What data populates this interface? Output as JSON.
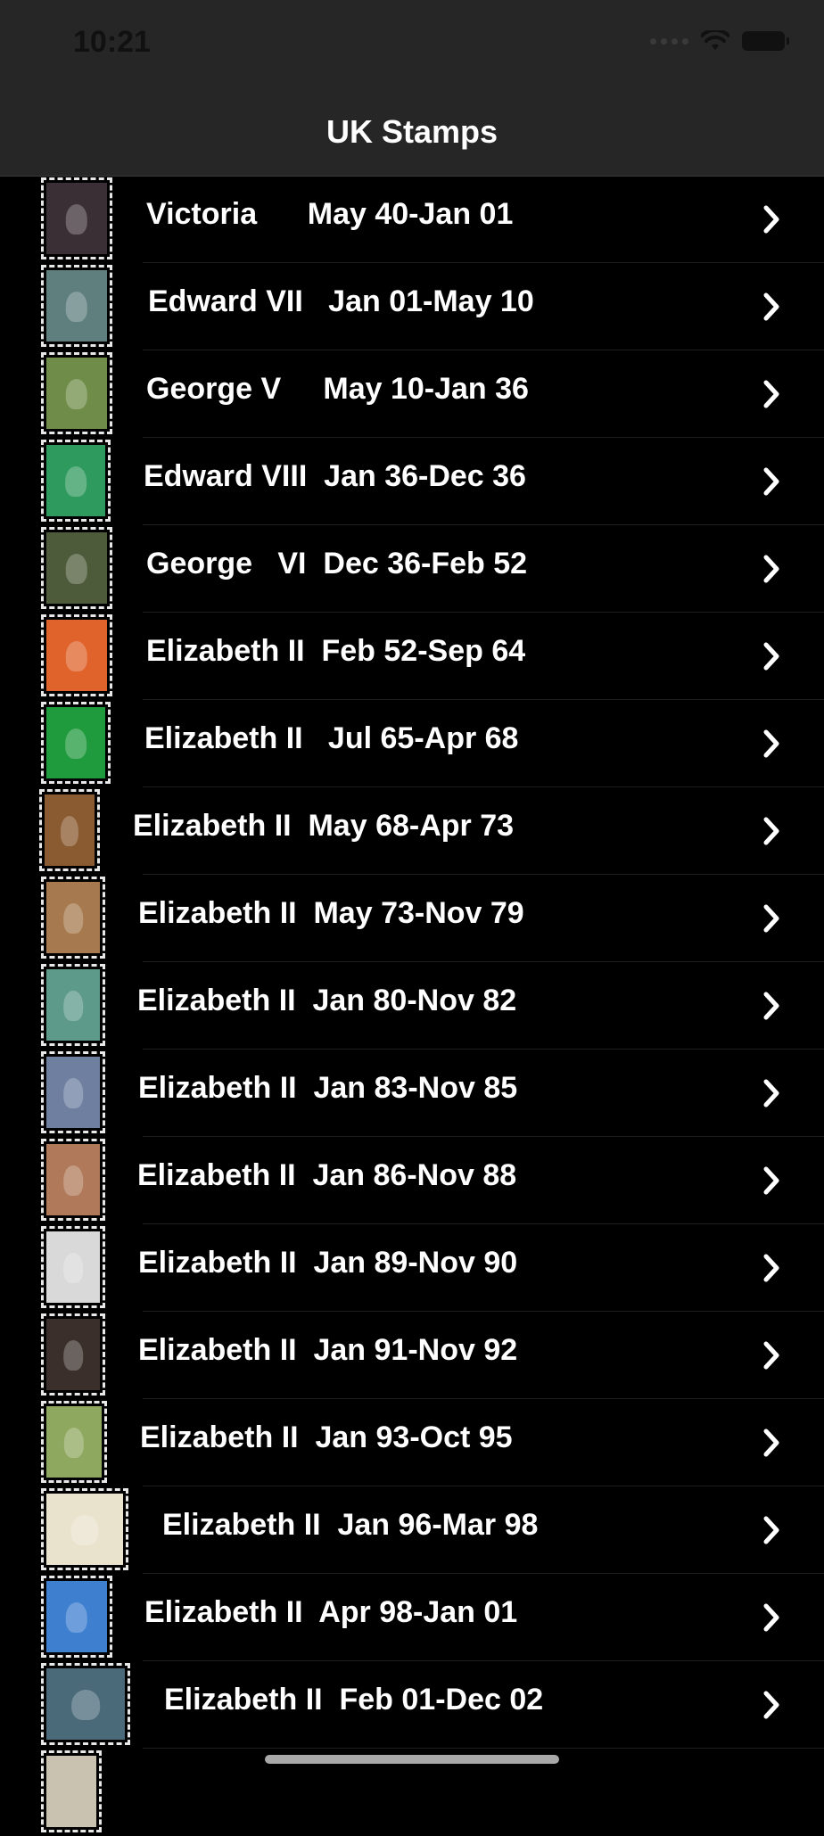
{
  "status": {
    "time": "10:21"
  },
  "nav": {
    "title": "UK Stamps"
  },
  "rows": [
    {
      "label": "Victoria      May 40-Jan 01",
      "stamp_color": "#3a2f35",
      "chevron_icon": "chevron-right-icon"
    },
    {
      "label": "Edward VII   Jan 01-May 10",
      "stamp_color": "#5f7f7e",
      "chevron_icon": "chevron-right-icon"
    },
    {
      "label": "George V     May 10-Jan 36",
      "stamp_color": "#6f8d48",
      "chevron_icon": "chevron-right-icon"
    },
    {
      "label": "Edward VIII  Jan 36-Dec 36",
      "stamp_color": "#2f9a5e",
      "chevron_icon": "chevron-right-icon"
    },
    {
      "label": "George   VI  Dec 36-Feb 52",
      "stamp_color": "#4e5b3a",
      "chevron_icon": "chevron-right-icon"
    },
    {
      "label": "Elizabeth II  Feb 52-Sep 64",
      "stamp_color": "#e0632b",
      "chevron_icon": "chevron-right-icon"
    },
    {
      "label": "Elizabeth II   Jul 65-Apr 68",
      "stamp_color": "#1f9a3c",
      "chevron_icon": "chevron-right-icon"
    },
    {
      "label": "Elizabeth II  May 68-Apr 73",
      "stamp_color": "#8a5a30",
      "chevron_icon": "chevron-right-icon"
    },
    {
      "label": "Elizabeth II  May 73-Nov 79",
      "stamp_color": "#a67a4e",
      "chevron_icon": "chevron-right-icon"
    },
    {
      "label": "Elizabeth II  Jan 80-Nov 82",
      "stamp_color": "#5e9a8a",
      "chevron_icon": "chevron-right-icon"
    },
    {
      "label": "Elizabeth II  Jan 83-Nov 85",
      "stamp_color": "#6e7fa0",
      "chevron_icon": "chevron-right-icon"
    },
    {
      "label": "Elizabeth II  Jan 86-Nov 88",
      "stamp_color": "#b07a5a",
      "chevron_icon": "chevron-right-icon"
    },
    {
      "label": "Elizabeth II  Jan 89-Nov 90",
      "stamp_color": "#d9d9d9",
      "chevron_icon": "chevron-right-icon"
    },
    {
      "label": "Elizabeth II  Jan 91-Nov 92",
      "stamp_color": "#3a2f2a",
      "chevron_icon": "chevron-right-icon"
    },
    {
      "label": "Elizabeth II  Jan 93-Oct 95",
      "stamp_color": "#8fa860",
      "chevron_icon": "chevron-right-icon"
    },
    {
      "label": "Elizabeth II  Jan 96-Mar 98",
      "stamp_color": "#e9e2cc",
      "chevron_icon": "chevron-right-icon"
    },
    {
      "label": "Elizabeth II  Apr 98-Jan 01",
      "stamp_color": "#3e7fd0",
      "chevron_icon": "chevron-right-icon"
    },
    {
      "label": "Elizabeth II  Feb 01-Dec 02",
      "stamp_color": "#4a6a7a",
      "chevron_icon": "chevron-right-icon"
    }
  ]
}
